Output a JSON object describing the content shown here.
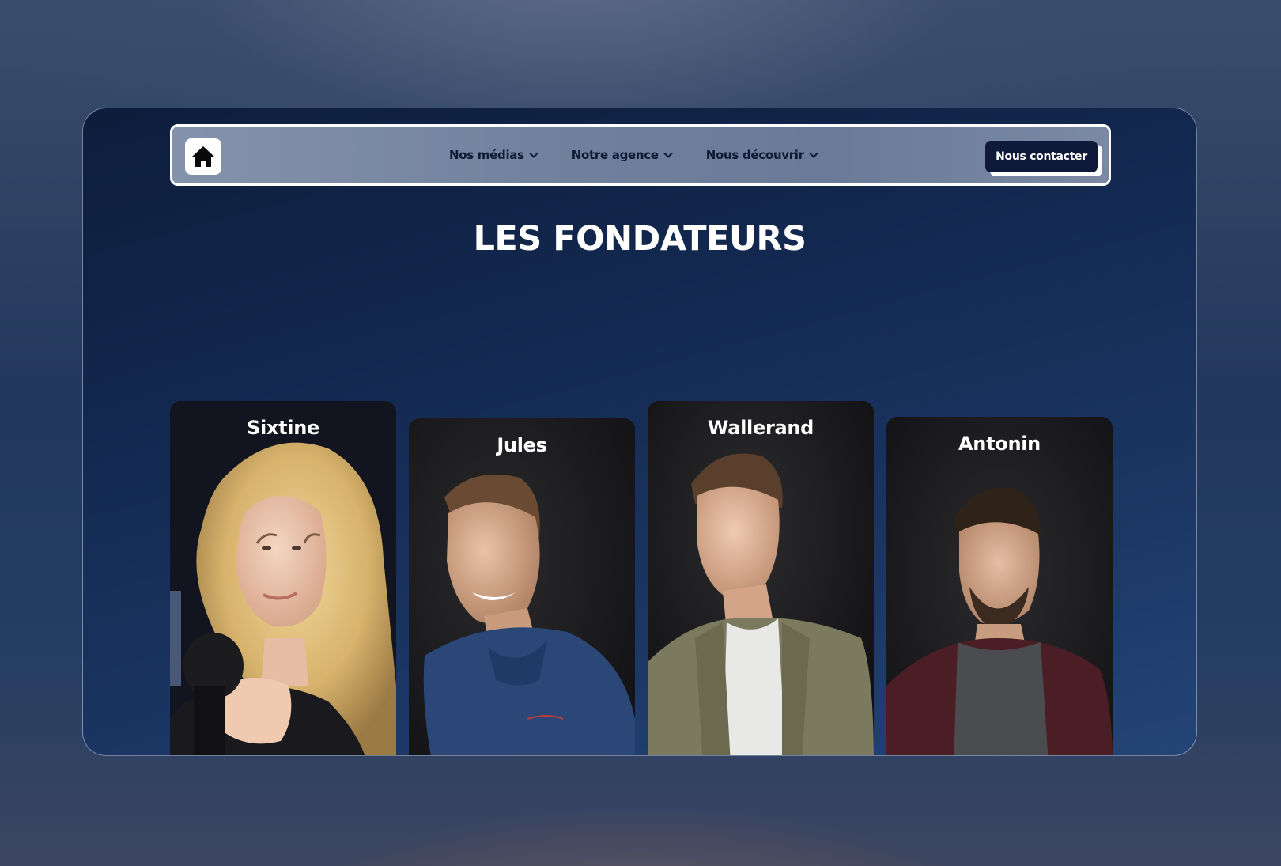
{
  "nav": {
    "home_icon": "home-icon",
    "links": [
      {
        "label": "Nos médias"
      },
      {
        "label": "Notre agence"
      },
      {
        "label": "Nous découvrir"
      }
    ],
    "cta_label": "Nous contacter"
  },
  "section": {
    "title": "LES FONDATEURS"
  },
  "founders": [
    {
      "name": "Sixtine"
    },
    {
      "name": "Jules"
    },
    {
      "name": "Wallerand"
    },
    {
      "name": "Antonin"
    }
  ]
}
